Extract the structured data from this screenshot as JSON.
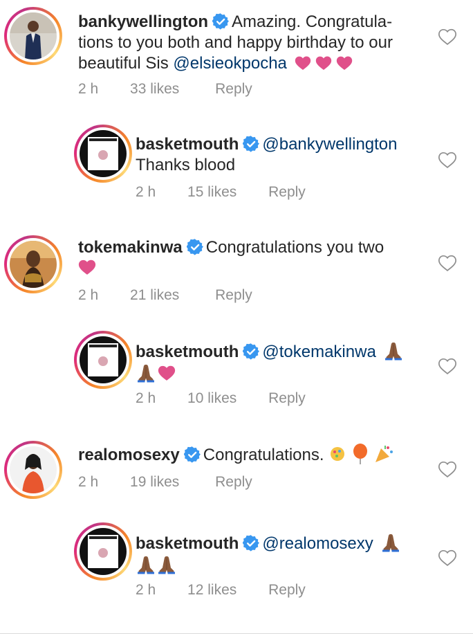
{
  "comments": [
    {
      "username": "bankywellington",
      "text_line1": "Amazing. Congratula-",
      "text_line2": "tions to you both and happy birthday to our",
      "text_line3": "beautiful Sis",
      "mention": "@elsieokpocha",
      "emojis": "❤❤❤",
      "time": "2 h",
      "likes": "33 likes",
      "reply": "Reply"
    },
    {
      "username": "basketmouth",
      "mention": "@bankywellington",
      "text_line2": "Thanks blood",
      "time": "2 h",
      "likes": "15 likes",
      "reply": "Reply"
    },
    {
      "username": "tokemakinwa",
      "text_line1": "Congratulations you two",
      "emojis": "❤",
      "time": "2 h",
      "likes": "21 likes",
      "reply": "Reply"
    },
    {
      "username": "basketmouth",
      "mention": "@tokemakinwa",
      "emojis": "🙏🏾",
      "emojis_line2": "🙏🏾❤",
      "time": "2 h",
      "likes": "10 likes",
      "reply": "Reply"
    },
    {
      "username": "realomosexy",
      "text_line1": "Congratulations.",
      "emojis": "🎊🎈🎉",
      "time": "2 h",
      "likes": "19 likes",
      "reply": "Reply"
    },
    {
      "username": "basketmouth",
      "mention": "@realomosexy",
      "emojis": "🙏🏾",
      "emojis_line2": "🙏🏾🙏🏾",
      "time": "2 h",
      "likes": "12 likes",
      "reply": "Reply"
    }
  ],
  "colors": {
    "text": "#262626",
    "mention": "#00376b",
    "meta": "#8e8e8e",
    "verified": "#3897f0",
    "pink_heart": "#e0508a"
  },
  "icons": {
    "verified": "verified-badge-icon",
    "like": "heart-outline-icon"
  }
}
